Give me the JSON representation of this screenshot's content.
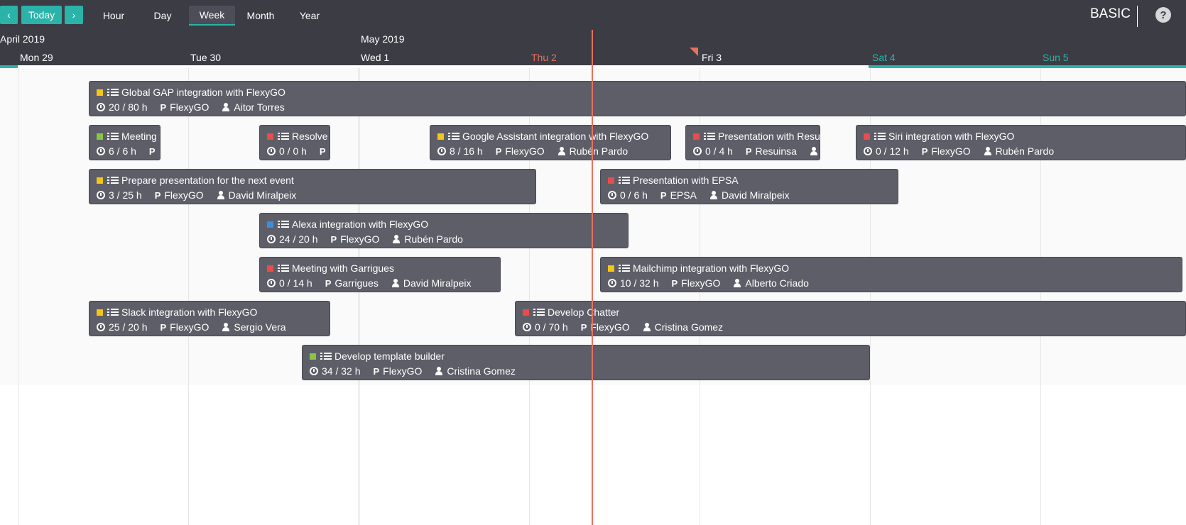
{
  "toolbar": {
    "prev_label": "‹",
    "today_label": "Today",
    "next_label": "›",
    "views": [
      "Hour",
      "Day",
      "Week",
      "Month",
      "Year"
    ],
    "active_view": "Week",
    "brand": "BASIC",
    "help_label": "?"
  },
  "timeline": {
    "months": [
      "April 2019",
      "May 2019"
    ],
    "days": [
      {
        "label": "Mon 29",
        "kind": "normal"
      },
      {
        "label": "Tue 30",
        "kind": "normal"
      },
      {
        "label": "Wed 1",
        "kind": "normal"
      },
      {
        "label": "Thu 2",
        "kind": "today"
      },
      {
        "label": "Fri 3",
        "kind": "normal"
      },
      {
        "label": "Sat 4",
        "kind": "weekend"
      },
      {
        "label": "Sun 5",
        "kind": "weekend"
      }
    ]
  },
  "colors": {
    "accent": "#2ab3a9",
    "header_bg": "#3b3c44",
    "task_bg": "#5d5e67",
    "today": "#e8705e",
    "status_yellow": "#f5c518",
    "status_red": "#e84c4c",
    "status_green": "#8bc34a",
    "status_blue": "#3b8de0"
  },
  "tasks": [
    {
      "title": "Global GAP integration with FlexyGO",
      "hours": "20 / 80 h",
      "project": "FlexyGO",
      "user": "Aitor Torres",
      "status": "yellow"
    },
    {
      "title": "Meeting with",
      "hours": "6 / 6 h",
      "project": "",
      "user": "",
      "status": "green"
    },
    {
      "title": "Resolve",
      "hours": "0 / 0 h",
      "project": "",
      "user": "",
      "status": "red"
    },
    {
      "title": "Google Assistant integration with FlexyGO",
      "hours": "8 / 16 h",
      "project": "FlexyGO",
      "user": "Rubén Pardo",
      "status": "yellow"
    },
    {
      "title": "Presentation with Resuinsa",
      "hours": "0 / 4 h",
      "project": "Resuinsa",
      "user": "",
      "status": "red"
    },
    {
      "title": "Siri integration with FlexyGO",
      "hours": "0 / 12 h",
      "project": "FlexyGO",
      "user": "Rubén Pardo",
      "status": "red"
    },
    {
      "title": "Prepare presentation for the next event",
      "hours": "3 / 25 h",
      "project": "FlexyGO",
      "user": "David Miralpeix",
      "status": "yellow"
    },
    {
      "title": "Presentation with EPSA",
      "hours": "0 / 6 h",
      "project": "EPSA",
      "user": "David Miralpeix",
      "status": "red"
    },
    {
      "title": "Alexa integration with FlexyGO",
      "hours": "24 / 20 h",
      "project": "FlexyGO",
      "user": "Rubén Pardo",
      "status": "blue"
    },
    {
      "title": "Meeting with Garrigues",
      "hours": "0 / 14 h",
      "project": "Garrigues",
      "user": "David Miralpeix",
      "status": "red"
    },
    {
      "title": "Mailchimp integration with FlexyGO",
      "hours": "10 / 32 h",
      "project": "FlexyGO",
      "user": "Alberto Criado",
      "status": "yellow"
    },
    {
      "title": "Slack integration with FlexyGO",
      "hours": "25 / 20 h",
      "project": "FlexyGO",
      "user": "Sergio Vera",
      "status": "yellow"
    },
    {
      "title": "Develop Chatter",
      "hours": "0 / 70 h",
      "project": "FlexyGO",
      "user": "Cristina Gomez",
      "status": "red"
    },
    {
      "title": "Develop template builder",
      "hours": "34 / 32 h",
      "project": "FlexyGO",
      "user": "Cristina Gomez",
      "status": "green"
    }
  ]
}
